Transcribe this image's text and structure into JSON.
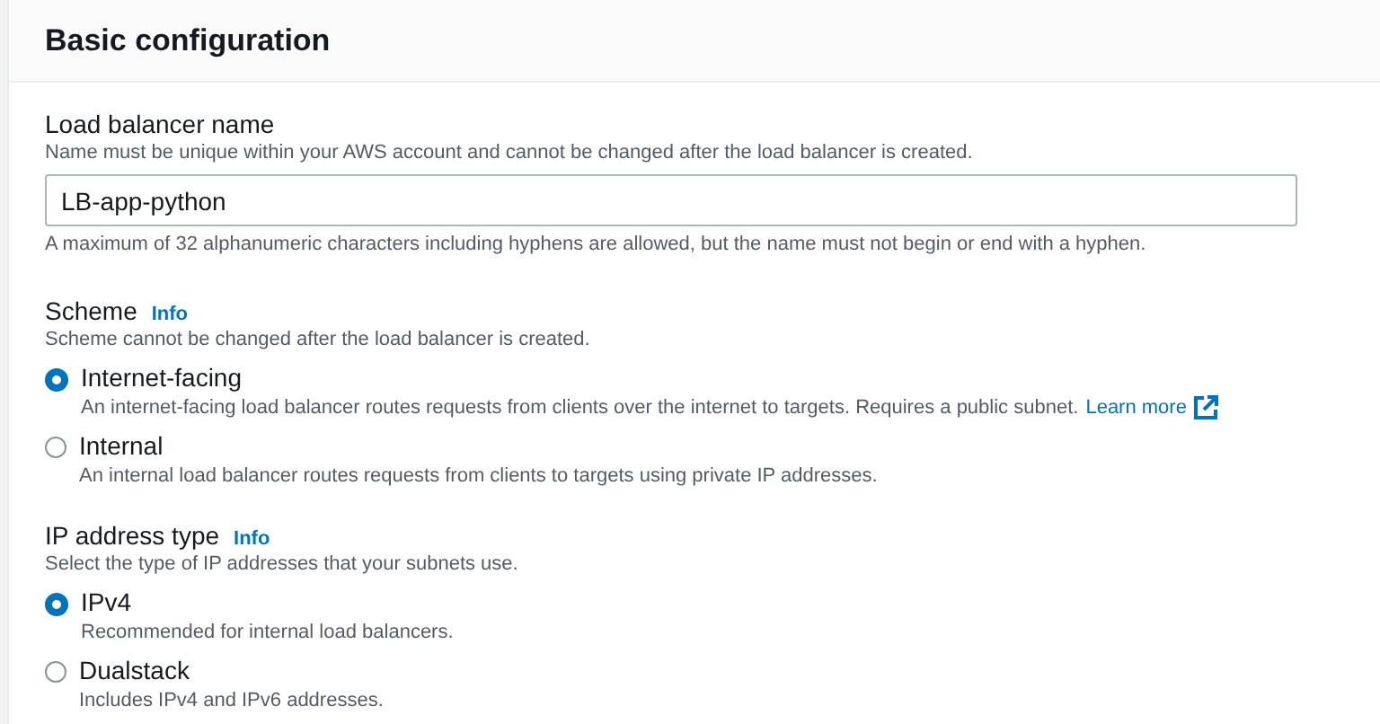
{
  "header": {
    "title": "Basic configuration"
  },
  "name_field": {
    "label": "Load balancer name",
    "description": "Name must be unique within your AWS account and cannot be changed after the load balancer is created.",
    "value": "LB-app-python",
    "constraint": "A maximum of 32 alphanumeric characters including hyphens are allowed, but the name must not begin or end with a hyphen."
  },
  "groups": [
    {
      "label": "Scheme",
      "info": "Info",
      "description": "Scheme cannot be changed after the load balancer is created.",
      "options": [
        {
          "label": "Internet-facing",
          "description": "An internet-facing load balancer routes requests from clients over the internet to targets. Requires a public subnet.",
          "link": "Learn more",
          "selected": true
        },
        {
          "label": "Internal",
          "description": "An internal load balancer routes requests from clients to targets using private IP addresses.",
          "selected": false
        }
      ]
    },
    {
      "label": "IP address type",
      "info": "Info",
      "description": "Select the type of IP addresses that your subnets use.",
      "options": [
        {
          "label": "IPv4",
          "description": "Recommended for internal load balancers.",
          "selected": true
        },
        {
          "label": "Dualstack",
          "description": "Includes IPv4 and IPv6 addresses.",
          "selected": false
        }
      ]
    }
  ]
}
